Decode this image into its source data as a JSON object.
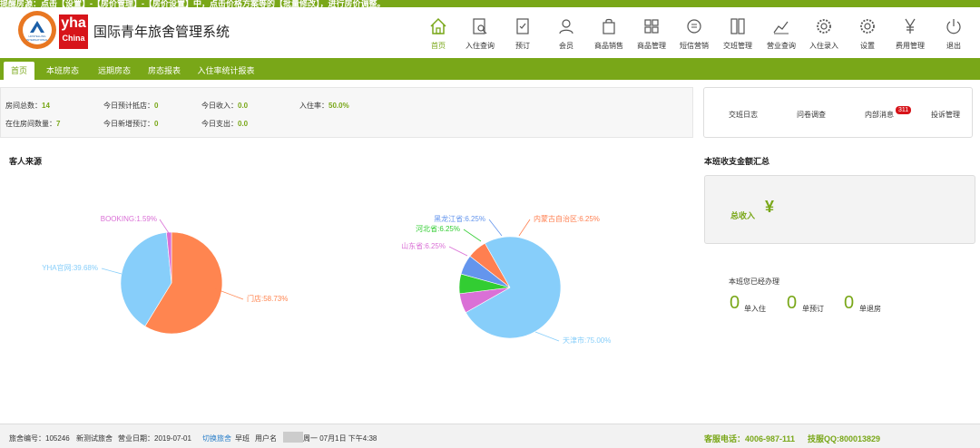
{
  "notice": "提醒房源：点击【设置】-【房价管理】-【房价设置】中，点击价格方案等的【批量修改】，进行房价调整。",
  "logo": {
    "brand": "yha",
    "brand_sub": "China",
    "hi_text": "HOSTELLING INTERNATIONAL",
    "brand_color": "#d7141a"
  },
  "header": {
    "title": "国际青年旅舍管理系统"
  },
  "nav": [
    {
      "label": "首页",
      "icon": "home-icon"
    },
    {
      "label": "入住查询",
      "icon": "checkin-search-icon"
    },
    {
      "label": "预订",
      "icon": "booking-icon"
    },
    {
      "label": "会员",
      "icon": "member-icon"
    },
    {
      "label": "商品销售",
      "icon": "shopping-bag-icon"
    },
    {
      "label": "商品管理",
      "icon": "grid-icon"
    },
    {
      "label": "短信营销",
      "icon": "sms-icon"
    },
    {
      "label": "交班管理",
      "icon": "shift-icon"
    },
    {
      "label": "营业查询",
      "icon": "chart-icon"
    },
    {
      "label": "入住录入",
      "icon": "settings-gear-icon"
    },
    {
      "label": "设置",
      "icon": "gear-icon"
    },
    {
      "label": "费用管理",
      "icon": "yen-icon"
    },
    {
      "label": "退出",
      "icon": "power-icon"
    }
  ],
  "tabs": [
    "首页",
    "本班房态",
    "远期房态",
    "房态报表",
    "入住率统计报表"
  ],
  "stats": {
    "room_total_label": "房间总数：",
    "room_total": "14",
    "occupied_label": "在住房间数量：",
    "occupied": "7",
    "expected_label": "今日预计抵店：",
    "expected": "0",
    "new_booking_label": "今日新增预订：",
    "new_booking": "0",
    "income_label": "今日收入：",
    "income": "0.0",
    "expense_label": "今日支出：",
    "expense": "0.0",
    "occupancy_label": "入住率：",
    "occupancy": "50.0%"
  },
  "quick_links": [
    "交班日志",
    "问卷调查",
    "内部消息",
    "投诉管理"
  ],
  "message_badge": "311",
  "sections": {
    "guest_source": "客人来源",
    "summary": "本班收支金额汇总"
  },
  "summary": {
    "total_income_label": "总收入",
    "yen": "¥",
    "done_title": "本班您已经办理",
    "checkin_count": "0",
    "checkin_label": "单入住",
    "booking_count": "0",
    "booking_label": "单预订",
    "checkout_count": "0",
    "checkout_label": "单退房"
  },
  "chart_data": [
    {
      "type": "pie",
      "title": "",
      "slices": [
        {
          "label": "门店",
          "value": 58.73,
          "text": "门店:58.73%",
          "color": "#ff8550"
        },
        {
          "label": "YHA官网",
          "value": 39.68,
          "text": "YHA官网:39.68%",
          "color": "#87cefa"
        },
        {
          "label": "BOOKING",
          "value": 1.59,
          "text": "BOOKING:1.59%",
          "color": "#da70d6"
        }
      ]
    },
    {
      "type": "pie",
      "title": "",
      "slices": [
        {
          "label": "天津市",
          "value": 75.0,
          "text": "天津市:75.00%",
          "color": "#87cefa"
        },
        {
          "label": "山东省",
          "value": 6.25,
          "text": "山东省:6.25%",
          "color": "#da70d6"
        },
        {
          "label": "河北省",
          "value": 6.25,
          "text": "河北省:6.25%",
          "color": "#32cd32"
        },
        {
          "label": "黑龙江省",
          "value": 6.25,
          "text": "黑龙江省:6.25%",
          "color": "#6495ed"
        },
        {
          "label": "内蒙古自治区",
          "value": 6.25,
          "text": "内蒙古自治区:6.25%",
          "color": "#ff7f50"
        }
      ]
    }
  ],
  "footer": {
    "hostel_id": "旅舍编号：105246",
    "hostel_name": "新测试旅舍",
    "biz_date": "营业日期：2019-07-01",
    "switch": "切换旅舍",
    "shift": "早班",
    "user": "用户名",
    "datetime": "周一 07月1日 下午4:38",
    "hotline": "客服电话：4006-987-111",
    "qq": "技服QQ:800013829"
  }
}
